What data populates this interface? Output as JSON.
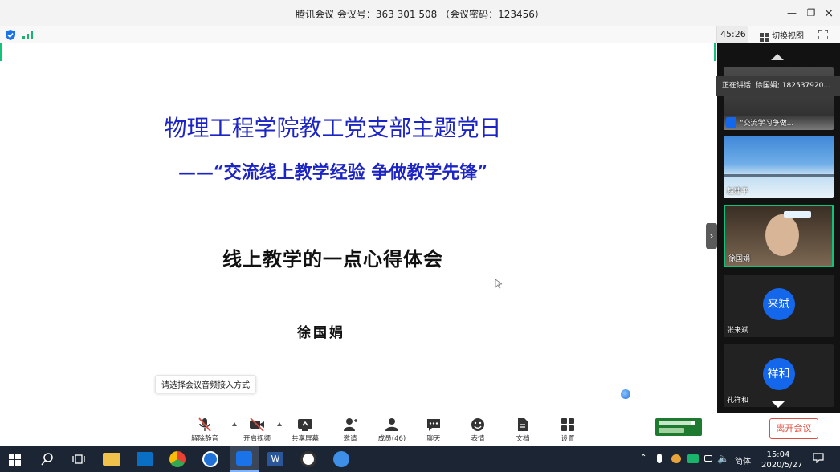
{
  "window": {
    "title": "腾讯会议 会议号：363 301 508 （会议密码：123456）"
  },
  "infobar": {
    "timer": "45:26",
    "switch_view_label": "切换视图"
  },
  "slide": {
    "title": "物理工程学院教工党支部主题党日",
    "subtitle": "——“交流线上教学经验  争做教学先锋”",
    "topic": "线上教学的一点心得体会",
    "author": "徐国娟"
  },
  "tooltip": {
    "text": "请选择会议音频接入方式"
  },
  "sidebar": {
    "speaking_text": "正在讲话: 徐国娟; 182537920...",
    "tiles": [
      {
        "name": "“交流学习争做..."
      },
      {
        "name": "赵建平"
      },
      {
        "name": "徐国娟"
      },
      {
        "name": "张来斌",
        "avatar_text": "来斌"
      },
      {
        "name": "孔祥和",
        "avatar_text": "祥和"
      }
    ]
  },
  "toolbar": {
    "unmute_label": "解除静音",
    "start_video_label": "开启视频",
    "share_screen_label": "共享屏幕",
    "invite_label": "邀请",
    "members_label": "成员(46)",
    "chat_label": "聊天",
    "emoji_label": "表情",
    "docs_label": "文档",
    "settings_label": "设置",
    "leave_label": "离开会议"
  },
  "taskbar": {
    "ime_label": "简体",
    "time": "15:04",
    "date": "2020/5/27"
  },
  "colors": {
    "accent_blue": "#1d24c4",
    "brand_green": "#13c27a",
    "leave_red": "#e04c3e",
    "avatar_blue": "#1467ea"
  }
}
